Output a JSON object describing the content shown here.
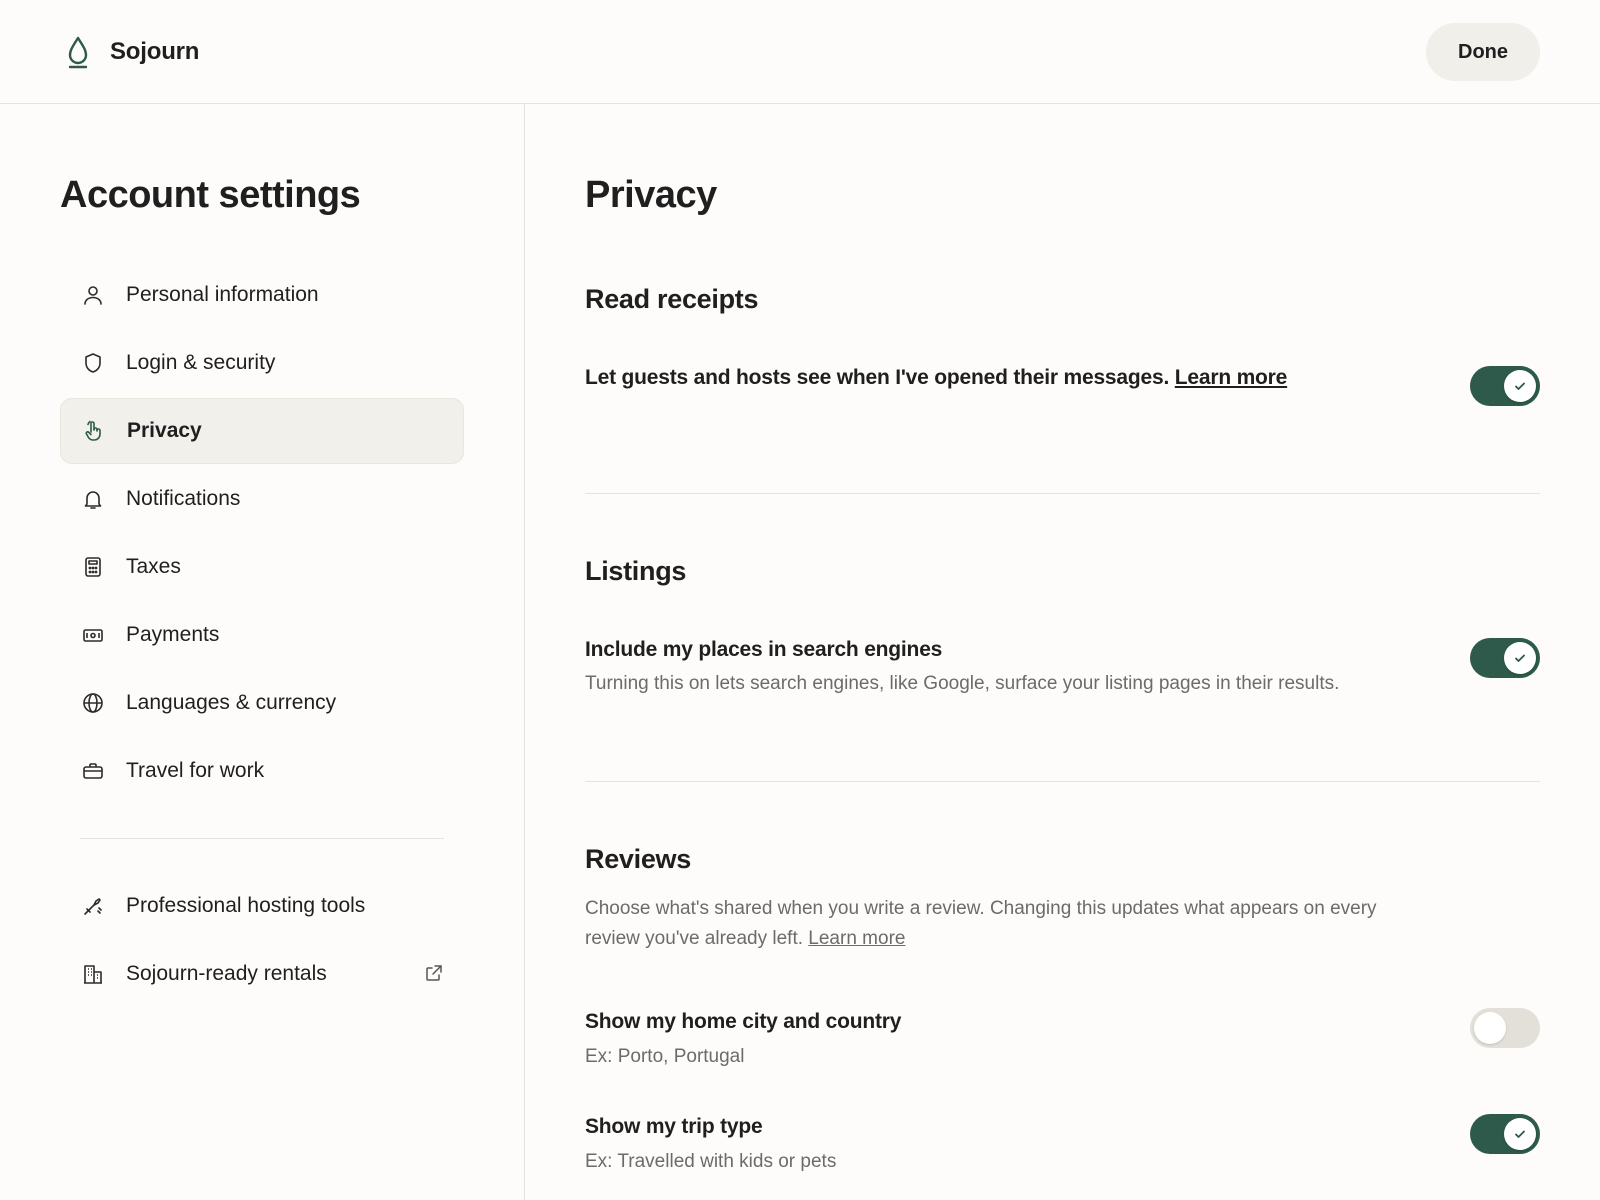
{
  "brand": {
    "name": "Sojourn",
    "logo_icon": "drop-icon"
  },
  "header": {
    "done_label": "Done"
  },
  "sidebar": {
    "title": "Account settings",
    "items": [
      {
        "label": "Personal information",
        "icon": "person-icon",
        "active": false
      },
      {
        "label": "Login & security",
        "icon": "shield-icon",
        "active": false
      },
      {
        "label": "Privacy",
        "icon": "hand-pointer-icon",
        "active": true
      },
      {
        "label": "Notifications",
        "icon": "bell-icon",
        "active": false
      },
      {
        "label": "Taxes",
        "icon": "calculator-icon",
        "active": false
      },
      {
        "label": "Payments",
        "icon": "banknote-icon",
        "active": false
      },
      {
        "label": "Languages & currency",
        "icon": "globe-icon",
        "active": false
      },
      {
        "label": "Travel for work",
        "icon": "briefcase-icon",
        "active": false
      }
    ],
    "secondary_items": [
      {
        "label": "Professional hosting tools",
        "icon": "hosting-tools-icon"
      },
      {
        "label": "Sojourn-ready rentals",
        "icon": "building-icon",
        "trailing_icon": "external-link-icon"
      }
    ]
  },
  "main": {
    "title": "Privacy",
    "sections": {
      "read_receipts": {
        "title": "Read receipts",
        "setting_text": "Let guests and hosts see when I've opened their messages.",
        "link_text": "Learn more",
        "enabled": true
      },
      "listings": {
        "title": "Listings",
        "setting_title": "Include my places in search engines",
        "setting_desc": "Turning this on lets search engines, like Google, surface your listing pages in their results.",
        "enabled": true
      },
      "reviews": {
        "title": "Reviews",
        "desc_line1": "Choose what's shared when you write a review. Changing this updates what appears on every",
        "desc_line2": "review you've already left.",
        "link_text": "Learn more",
        "settings": [
          {
            "title": "Show my home city and country",
            "desc": "Ex: Porto, Portugal",
            "enabled": false
          },
          {
            "title": "Show my trip type",
            "desc": "Ex: Travelled with kids or pets",
            "enabled": true
          }
        ]
      }
    }
  },
  "colors": {
    "accent": "#2d5a4a",
    "toggle_off": "#e3e0d9",
    "background": "#fdfcfa",
    "active_nav_bg": "#f2f0ea",
    "muted_text": "#6b6b6b"
  }
}
